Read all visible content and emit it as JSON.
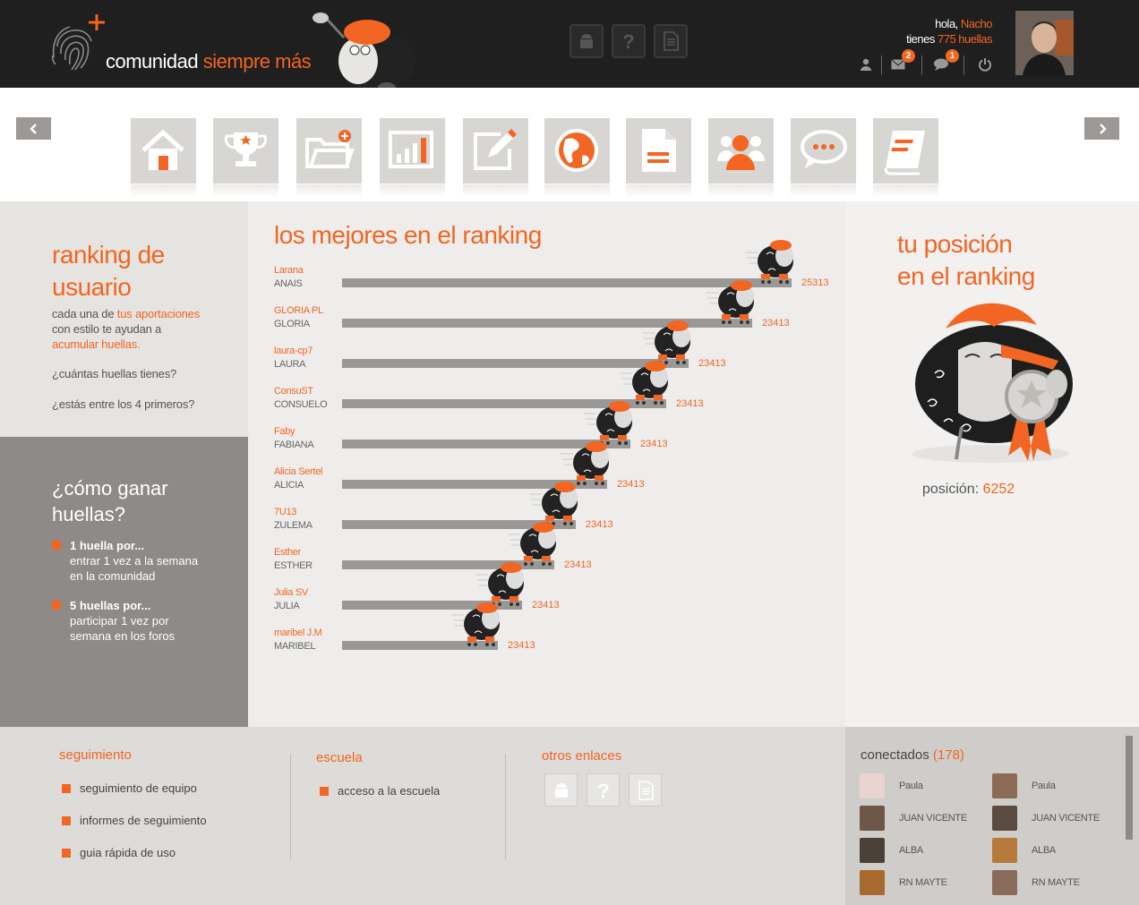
{
  "header": {
    "logo_text": "comunidad",
    "logo_text_accent": "siempre más",
    "greeting_prefix": "hola,",
    "user_name": "Nacho",
    "huellas_prefix": "tienes",
    "huellas_value": "775 huellas",
    "buttons": [
      "android-icon",
      "help-icon",
      "document-icon"
    ],
    "mail_badge": "2",
    "chat_badge": "1"
  },
  "nav": {
    "tiles": [
      "home",
      "trophy",
      "new-folder",
      "stats",
      "edit",
      "globe",
      "document",
      "users",
      "chat",
      "notebook"
    ]
  },
  "left": {
    "title_line1": "ranking de",
    "title_line2": "usuario",
    "desc_prefix": "cada una de",
    "desc_link": "tus aportaciones",
    "desc_middle": "con estilo te ayudan a",
    "desc_link2": "acumular huellas.",
    "q1_pre": "¿cuántas",
    "q1_post": "huellas tienes?",
    "q2_pre": "¿estás entre los",
    "q2_bold": "4 primeros",
    "q2_post": "?"
  },
  "how": {
    "title_line1": "¿cómo ganar",
    "title_line2": "huellas?",
    "items": [
      {
        "head": "1 huella por...",
        "line1": "entrar 1 vez a la semana",
        "line2": "en la comunidad"
      },
      {
        "head": "5 huellas por...",
        "line1": "participar 1 vez por",
        "line2": "semana en los foros"
      }
    ]
  },
  "ranking": {
    "title": "los mejores en el ranking",
    "rows": [
      {
        "user": "Larana",
        "name": "ANAIS",
        "score": 25313
      },
      {
        "user": "GLORIA PL",
        "name": "GLORIA",
        "score": 23413
      },
      {
        "user": "laura-cp7",
        "name": "LAURA",
        "score": 23413
      },
      {
        "user": "ConsuST",
        "name": "CONSUELO",
        "score": 23413
      },
      {
        "user": "Faby",
        "name": "FABIANA",
        "score": 23413
      },
      {
        "user": "Alicia Sertel",
        "name": "ALICIA",
        "score": 23413
      },
      {
        "user": "7U13",
        "name": "ZULEMA",
        "score": 23413
      },
      {
        "user": "Esther",
        "name": "ESTHER",
        "score": 23413
      },
      {
        "user": "Julia SV",
        "name": "JULIA",
        "score": 23413
      },
      {
        "user": "maribel J.M",
        "name": "MARIBEL",
        "score": 23413
      }
    ]
  },
  "position": {
    "title_line1": "tu posición",
    "title_line2": "en el ranking",
    "label": "posición:",
    "value": "6252"
  },
  "footer": {
    "seguimiento_title": "seguimiento",
    "seguimiento_links": [
      "seguimiento de equipo",
      "informes de seguimiento",
      "guia rápida de uso"
    ],
    "escuela_title": "escuela",
    "escuela_links": [
      "acceso a la escuela"
    ],
    "otros_title": "otros enlaces"
  },
  "online": {
    "title": "conectados",
    "count": "(178)",
    "users": [
      {
        "name": "Paula",
        "color": "#e9d4cf"
      },
      {
        "name": "Paula",
        "color": "#8c6a55"
      },
      {
        "name": "JUAN VICENTE",
        "color": "#6e5648"
      },
      {
        "name": "JUAN VICENTE",
        "color": "#5b4a40"
      },
      {
        "name": "ALBA",
        "color": "#4a4036"
      },
      {
        "name": "ALBA",
        "color": "#b87a3a"
      },
      {
        "name": "RN MAYTE",
        "color": "#a8692e"
      },
      {
        "name": "RN MAYTE",
        "color": "#8a6a5a"
      }
    ]
  }
}
